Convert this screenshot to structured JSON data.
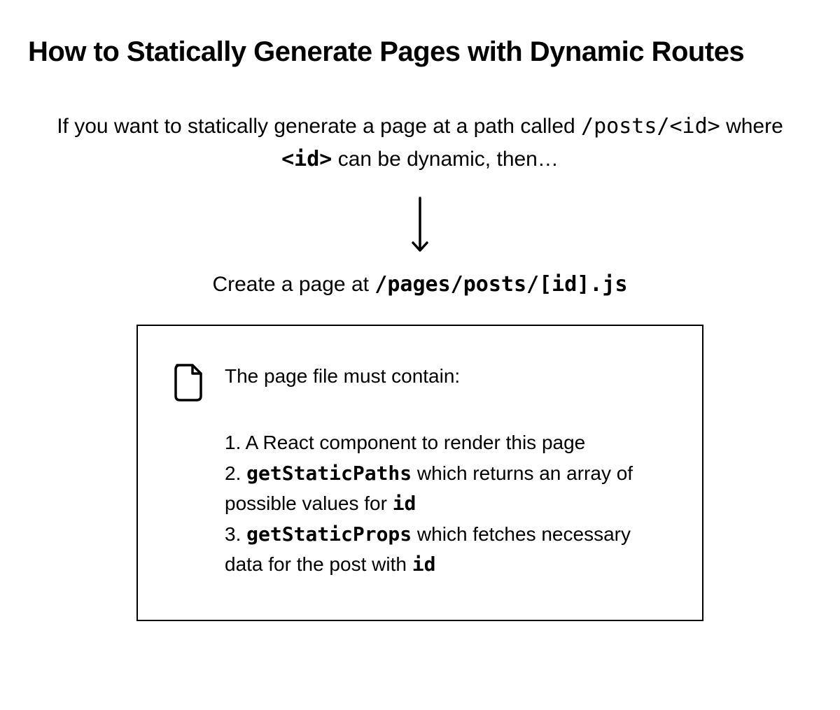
{
  "title": "How to Statically Generate Pages with Dynamic Routes",
  "intro": {
    "text_before_path": "If you want to statically generate a page at a path called ",
    "path": "/posts/<id>",
    "text_where": " where ",
    "id_code": "<id>",
    "text_after": " can be dynamic, then…"
  },
  "create_line": {
    "text": "Create a page at ",
    "path": "/pages/posts/[id].js"
  },
  "box": {
    "heading": "The page file must contain:",
    "items": [
      {
        "num": "1.",
        "before": " A React component to render this page",
        "code": "",
        "after": ""
      },
      {
        "num": "2.",
        "before": " ",
        "code": "getStaticPaths",
        "after": " which returns an array of possible values for ",
        "code2": "id"
      },
      {
        "num": "3.",
        "before": " ",
        "code": "getStaticProps",
        "after": " which fetches necessary data for the post with ",
        "code2": "id"
      }
    ]
  }
}
